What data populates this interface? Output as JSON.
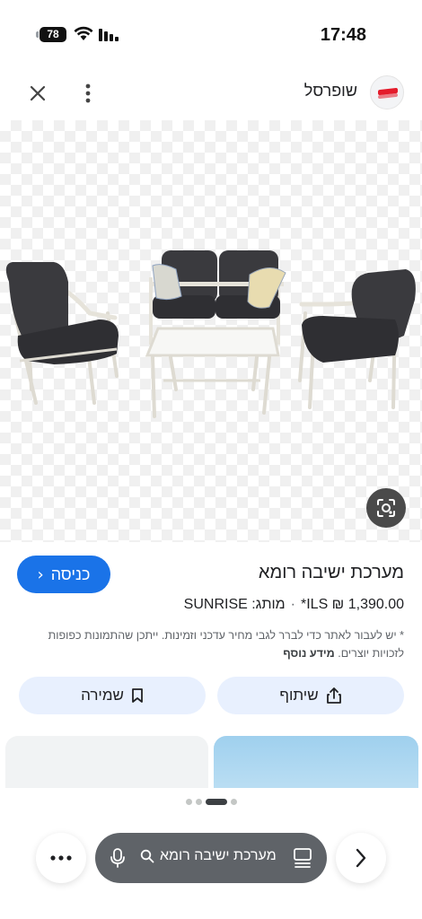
{
  "status_bar": {
    "time": "17:48",
    "battery_level": "78"
  },
  "header": {
    "site_name": "שופרסל",
    "icons": [
      "close-icon",
      "more-vert-icon",
      "site-logo"
    ]
  },
  "product": {
    "title": "מערכת ישיבה רומא",
    "visit_label": "כניסה",
    "price": "1,390.00 ₪ ILS*",
    "brand_label": "מותג:",
    "brand": "SUNRISE",
    "disclaimer": "* יש לעבור לאתר כדי לברר לגבי מחיר עדכני וזמינות. ייתכן שהתמונות כפופות לזכויות יוצרים.",
    "more_info": "מידע נוסף"
  },
  "actions": {
    "share_label": "שיתוף",
    "save_label": "שמירה"
  },
  "pager": {
    "total": 4,
    "active_index": 2
  },
  "search": {
    "query": "מערכת ישיבה רומא"
  },
  "colors": {
    "accent": "#1a73e8",
    "action_bg": "#e8f0fe",
    "search_pill": "#5f6368"
  }
}
